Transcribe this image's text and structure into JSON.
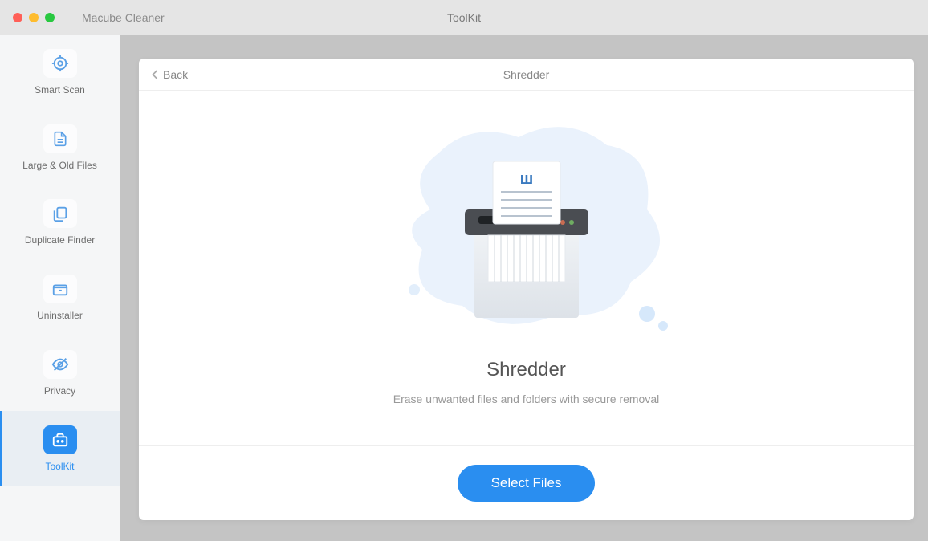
{
  "titlebar": {
    "app_name": "Macube Cleaner",
    "center_title": "ToolKit"
  },
  "sidebar": {
    "items": [
      {
        "label": "Smart Scan",
        "icon": "target-icon",
        "active": false
      },
      {
        "label": "Large & Old Files",
        "icon": "file-icon",
        "active": false
      },
      {
        "label": "Duplicate Finder",
        "icon": "duplicate-icon",
        "active": false
      },
      {
        "label": "Uninstaller",
        "icon": "box-icon",
        "active": false
      },
      {
        "label": "Privacy",
        "icon": "eye-off-icon",
        "active": false
      },
      {
        "label": "ToolKit",
        "icon": "toolbox-icon",
        "active": true
      }
    ]
  },
  "card": {
    "back_label": "Back",
    "header_title": "Shredder",
    "feature_title": "Shredder",
    "feature_subtitle": "Erase unwanted files and folders with secure removal",
    "primary_button": "Select Files"
  }
}
